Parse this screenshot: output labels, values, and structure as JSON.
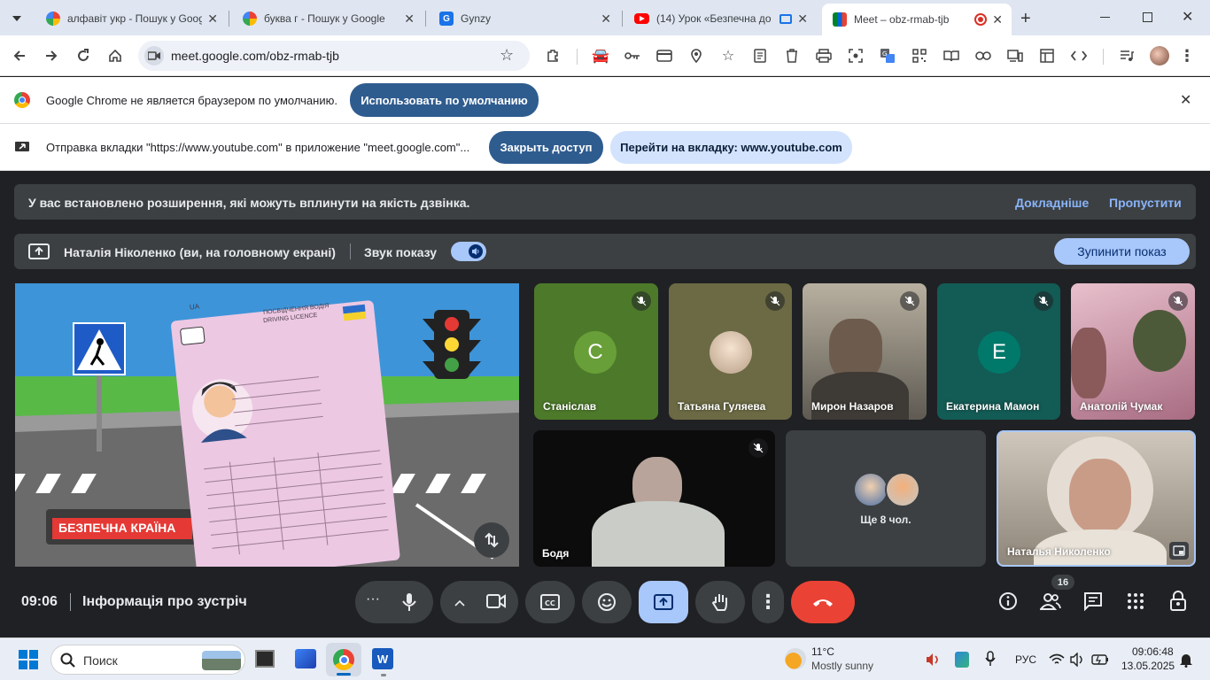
{
  "tabs": [
    {
      "title": "алфавіт укр - Пошук у Google",
      "icon": "google-icon"
    },
    {
      "title": "буква г - Пошук у Google",
      "icon": "google-icon"
    },
    {
      "title": "Gynzy",
      "icon": "gynzy-icon",
      "letter": "G"
    },
    {
      "title": "(14) Урок «Безпечна до",
      "icon": "youtube-icon"
    },
    {
      "title": "Meet – obz-rmab-tjb",
      "icon": "meet-icon"
    }
  ],
  "toolbar": {
    "url": "meet.google.com/obz-rmab-tjb"
  },
  "default_bar": {
    "text": "Google Chrome не является браузером по умолчанию.",
    "button": "Использовать по умолчанию"
  },
  "share_bar": {
    "text": "Отправка вкладки \"https://www.youtube.com\" в приложение \"meet.google.com\"...",
    "stop": "Закрыть доступ",
    "goto": "Перейти на вкладку: www.youtube.com"
  },
  "ext_banner": {
    "text": "У вас встановлено розширення, які можуть вплинути на якість дзвінка.",
    "more": "Докладніше",
    "skip": "Пропустити"
  },
  "present_bar": {
    "presenter": "Наталія Ніколенко (ви, на головному екрані)",
    "sound_label": "Звук показу",
    "stop": "Зупинити показ"
  },
  "shared_screen": {
    "sign": "БЕЗПЕЧНА КРАЇНА",
    "licence_header": "ПОСВІДЧЕННЯ ВОДІЯ",
    "licence_sub": "DRIVING LICENCE",
    "licence_country": "UA"
  },
  "participants": [
    {
      "name": "Станіслав",
      "initial": "С",
      "bg": "#4d7a2a",
      "avatar_color": "#689f38"
    },
    {
      "name": "Татьяна Гуляева",
      "bg": "#6b6a44"
    },
    {
      "name": "Мирон Назаров",
      "bg": "#8a8578"
    },
    {
      "name": "Екатерина Мамон",
      "initial": "Е",
      "bg": "#135b55",
      "avatar_color": "#00796b"
    },
    {
      "name": "Анатолій Чумак",
      "bg": "#c79aa8"
    },
    {
      "name": "Бодя",
      "bg": "#0c0c0c"
    },
    {
      "name": "Наталья Николенко",
      "bg": "#b9b1a6"
    }
  ],
  "others": {
    "label": "Ще 8 чол."
  },
  "bottom": {
    "time": "09:06",
    "meeting_info": "Інформація про зустріч",
    "people_count": "16"
  },
  "taskbar": {
    "search": "Поиск",
    "weather_temp": "11°C",
    "weather_desc": "Mostly sunny",
    "lang": "РУС",
    "time": "09:06:48",
    "date": "13.05.2025"
  },
  "colors": {
    "meet_bg": "#202124",
    "banner": "#3c4043",
    "link": "#8ab4f8",
    "end_call": "#ea4335",
    "present_active": "#a8c7fa",
    "pill_dark": "#2f5c8f"
  }
}
